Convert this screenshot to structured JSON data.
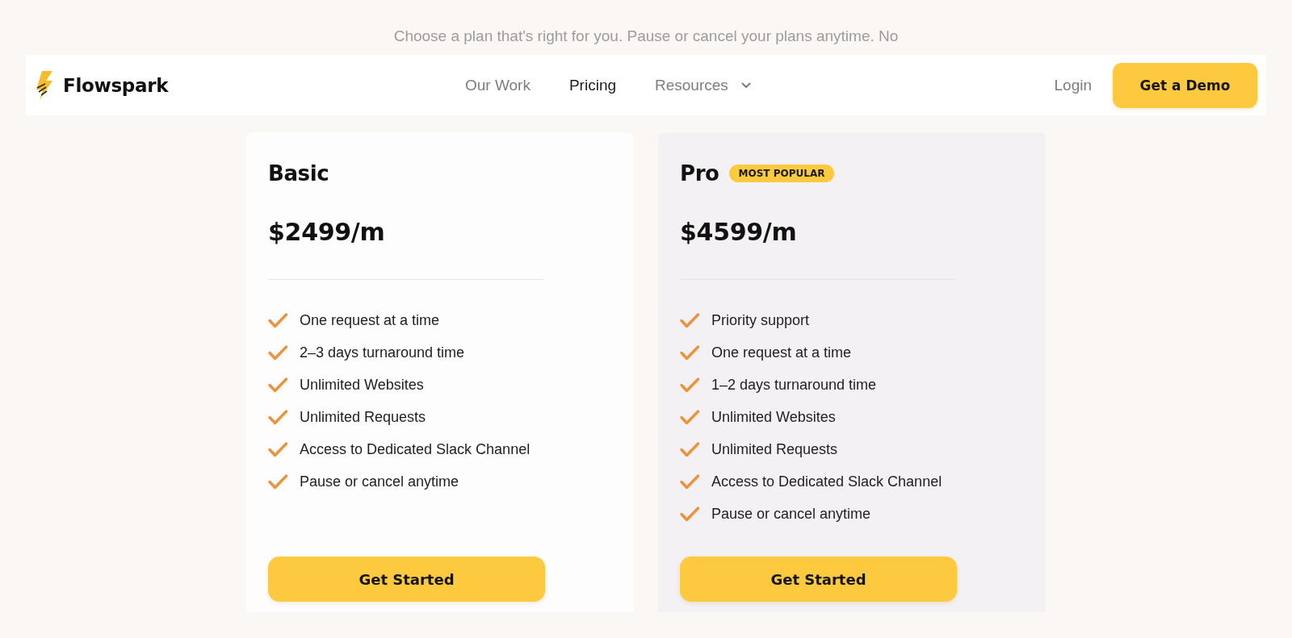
{
  "subtitle": "Choose a plan that's right for you. Pause or cancel your plans anytime. No",
  "navbar": {
    "brand": "Flowspark",
    "links": [
      {
        "label": "Our Work",
        "selected": false,
        "dropdown": false
      },
      {
        "label": "Pricing",
        "selected": true,
        "dropdown": false
      },
      {
        "label": "Resources",
        "selected": false,
        "dropdown": true
      }
    ],
    "login": "Login",
    "cta": "Get a Demo"
  },
  "plans": [
    {
      "name": "Basic",
      "featured": false,
      "price": "$2499/m",
      "features": [
        "One request at a time",
        "2–3 days turnaround time",
        "Unlimited Websites",
        "Unlimited Requests",
        "Access to Dedicated Slack Channel",
        "Pause or cancel anytime"
      ],
      "button": "Get Started"
    },
    {
      "name": "Pro",
      "badge": "MOST POPULAR",
      "featured": true,
      "price": "$4599/m",
      "features": [
        "Priority support",
        "One request at a time",
        "1–2 days turnaround time",
        "Unlimited Websites",
        "Unlimited Requests",
        "Access to Dedicated Slack Channel",
        "Pause or cancel anytime"
      ],
      "button": "Get Started"
    }
  ]
}
